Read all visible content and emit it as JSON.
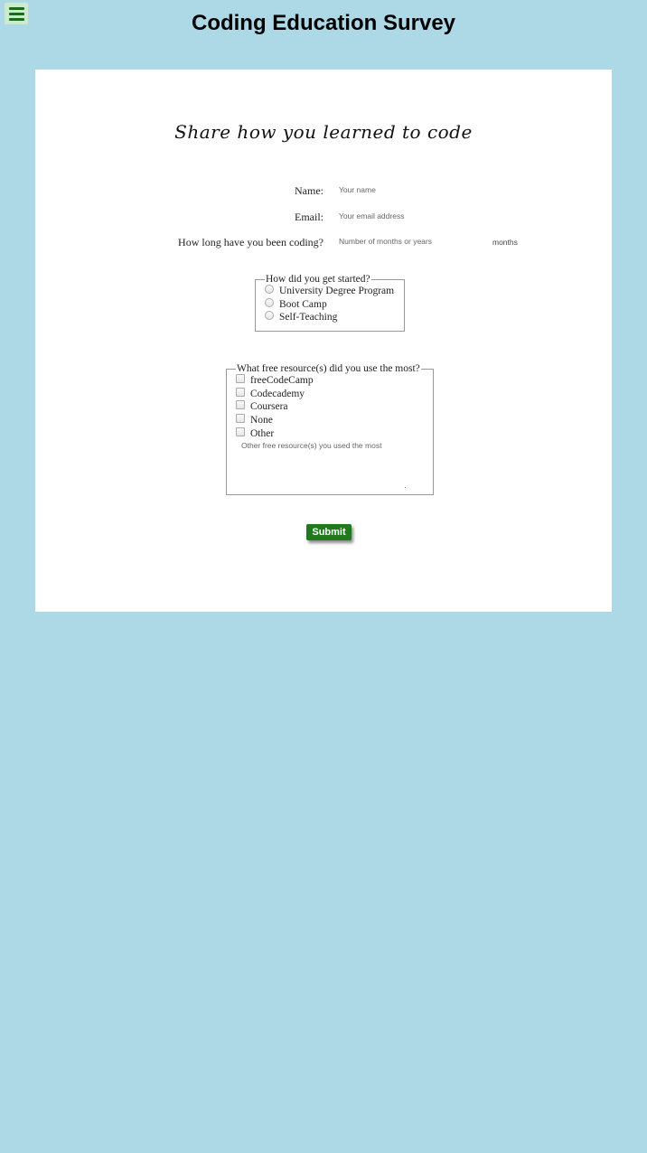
{
  "header": {
    "menu_icon": "hamburger-menu-icon",
    "title": "Coding Education Survey"
  },
  "form": {
    "subtitle": "Share how you learned to code",
    "name": {
      "label": "Name:",
      "placeholder": "Your name",
      "value": ""
    },
    "email": {
      "label": "Email:",
      "placeholder": "Your email address",
      "value": ""
    },
    "duration": {
      "label": "How long have you been coding?",
      "placeholder": "Number of months or years",
      "value": "",
      "unit": "months"
    },
    "started": {
      "legend": "How did you get started?",
      "options": [
        "University Degree Program",
        "Boot Camp",
        "Self-Teaching"
      ]
    },
    "resources": {
      "legend": "What free resource(s) did you use the most?",
      "options": [
        "freeCodeCamp",
        "Codecademy",
        "Coursera",
        "None",
        "Other"
      ],
      "other_placeholder": "Other free resource(s) you used the most"
    },
    "submit_label": "Submit"
  },
  "colors": {
    "page_background": "#add8e6",
    "card_background": "#ffffff",
    "submit_background": "#1f7a1f",
    "menu_icon": "#1a6b1a"
  }
}
